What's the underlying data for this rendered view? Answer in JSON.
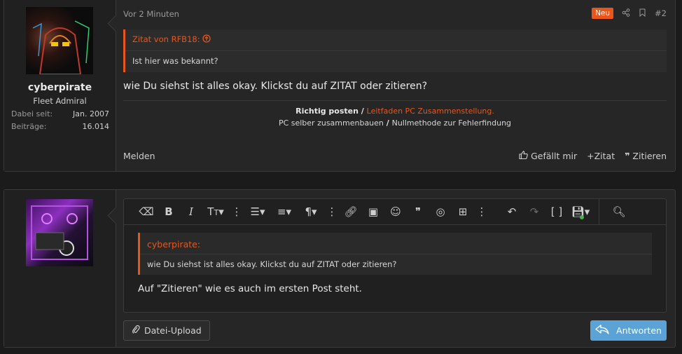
{
  "post1": {
    "user": {
      "name": "cyberpirate",
      "title": "Fleet Admiral",
      "stats": [
        {
          "label": "Dabei seit:",
          "value": "Jan. 2007"
        },
        {
          "label": "Beiträge:",
          "value": "16.014"
        }
      ]
    },
    "time": "Vor 2 Minuten",
    "badge": "Neu",
    "post_number": "#2",
    "quote": {
      "header": "Zitat von RFB18:",
      "body": "Ist hier was bekannt?"
    },
    "message": "wie Du siehst ist alles okay. Klickst du auf ZITAT oder zitieren?",
    "signature": {
      "line1_bold": "Richtig posten",
      "line1_sep": " / ",
      "line1_link": "Leitfaden PC Zusammenstellung.",
      "line2_a": "PC selber zusammenbauen",
      "line2_sep": " / ",
      "line2_b": "Nullmethode zur Fehlerfindung"
    },
    "footer": {
      "report": "Melden",
      "like": "Gefällt mir",
      "quote": "Zitat",
      "cite": "Zitieren"
    }
  },
  "editor": {
    "toolbar_icons": [
      "eraser-icon",
      "bold-icon",
      "italic-icon",
      "text-size-icon",
      "more-icon",
      "list-icon",
      "align-icon",
      "paragraph-icon",
      "more-icon",
      "link-icon",
      "image-icon",
      "smiley-icon",
      "quote-icon",
      "spoiler-icon",
      "table-icon",
      "more-icon",
      "undo-icon",
      "redo-icon",
      "code-icon",
      "drafts-icon",
      "preview-icon"
    ],
    "quote": {
      "header": "cyberpirate:",
      "body": "wie Du siehst ist alles okay. Klickst du auf ZITAT oder zitieren?"
    },
    "typed_text": "Auf \"Zitieren\" wie es auch im ersten Post steht.",
    "upload_label": "Datei-Upload",
    "reply_label": "Antworten"
  },
  "colors": {
    "accent": "#e8561c",
    "button": "#5ba3d6"
  }
}
